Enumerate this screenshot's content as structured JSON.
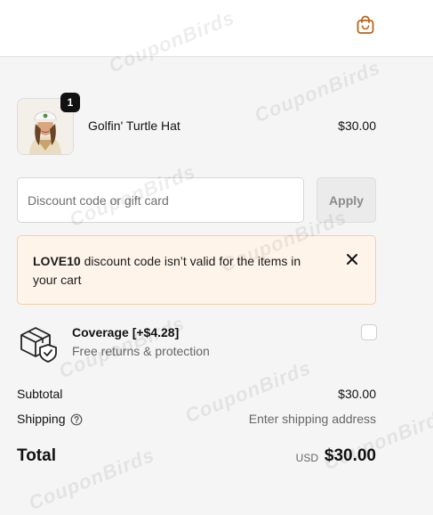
{
  "header": {
    "bag_icon": "shopping-bag-icon",
    "accent_color": "#b7661e"
  },
  "product": {
    "name": "Golfin' Turtle Hat",
    "price": "$30.00",
    "quantity": "1",
    "image_icon": "product-photo"
  },
  "discount": {
    "placeholder": "Discount code or gift card",
    "value": "",
    "apply_label": "Apply"
  },
  "error": {
    "code": "LOVE10",
    "message": " discount code isn’t valid for the items in your cart",
    "close_icon": "close-icon"
  },
  "coverage": {
    "title": "Coverage [+$4.28]",
    "subtitle": "Free returns & protection",
    "checked": false,
    "icon": "package-shield-icon"
  },
  "summary": {
    "subtotal_label": "Subtotal",
    "subtotal_value": "$30.00",
    "shipping_label": "Shipping",
    "shipping_value": "Enter shipping address",
    "help_icon": "question-circle-icon",
    "total_label": "Total",
    "currency": "USD",
    "total_value": "$30.00"
  },
  "watermark": "CouponBirds"
}
